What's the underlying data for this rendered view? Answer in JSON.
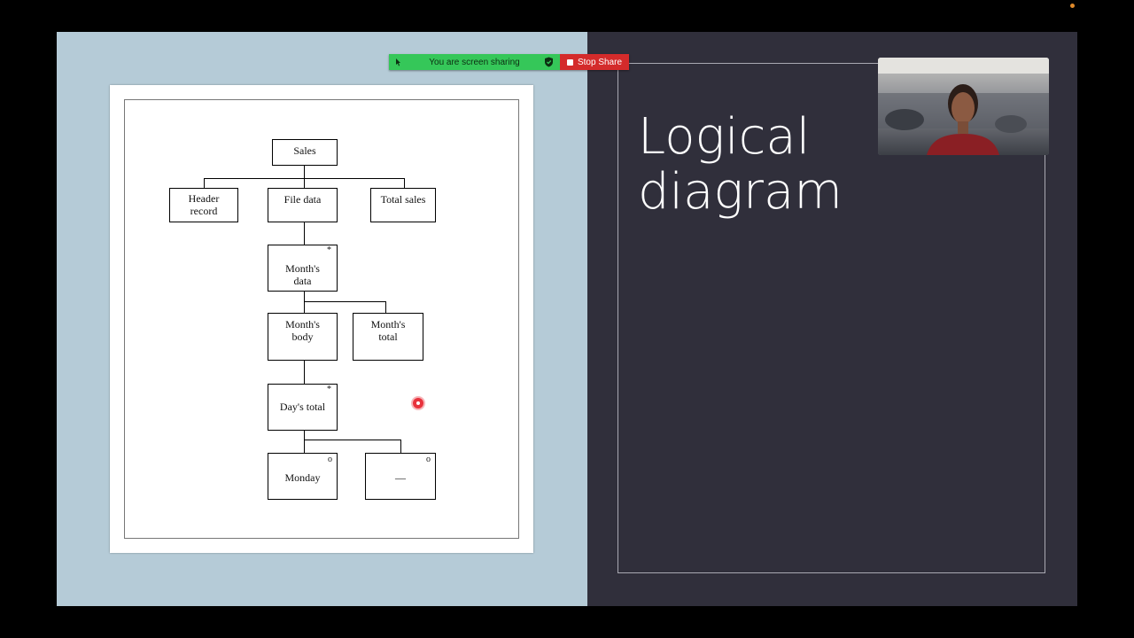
{
  "slide": {
    "title": "Logical\ndiagram"
  },
  "diagram": {
    "nodes": {
      "sales": "Sales",
      "header_record": "Header\nrecord",
      "file_data": "File data",
      "total_sales": "Total sales",
      "months_data": "Month's\ndata",
      "months_body": "Month's\nbody",
      "months_total": "Month's\ntotal",
      "days_total": "Day's total",
      "monday": "Monday",
      "dash": "—"
    },
    "iteration_mark": "*",
    "selection_mark": "o"
  },
  "share_bar": {
    "status_text": "You are screen sharing",
    "stop_label": "Stop Share"
  },
  "colors": {
    "share_green": "#35c759",
    "stop_red": "#d42b2b",
    "slide_left_bg": "#b5cbd7",
    "slide_right_bg": "#302f3b"
  }
}
